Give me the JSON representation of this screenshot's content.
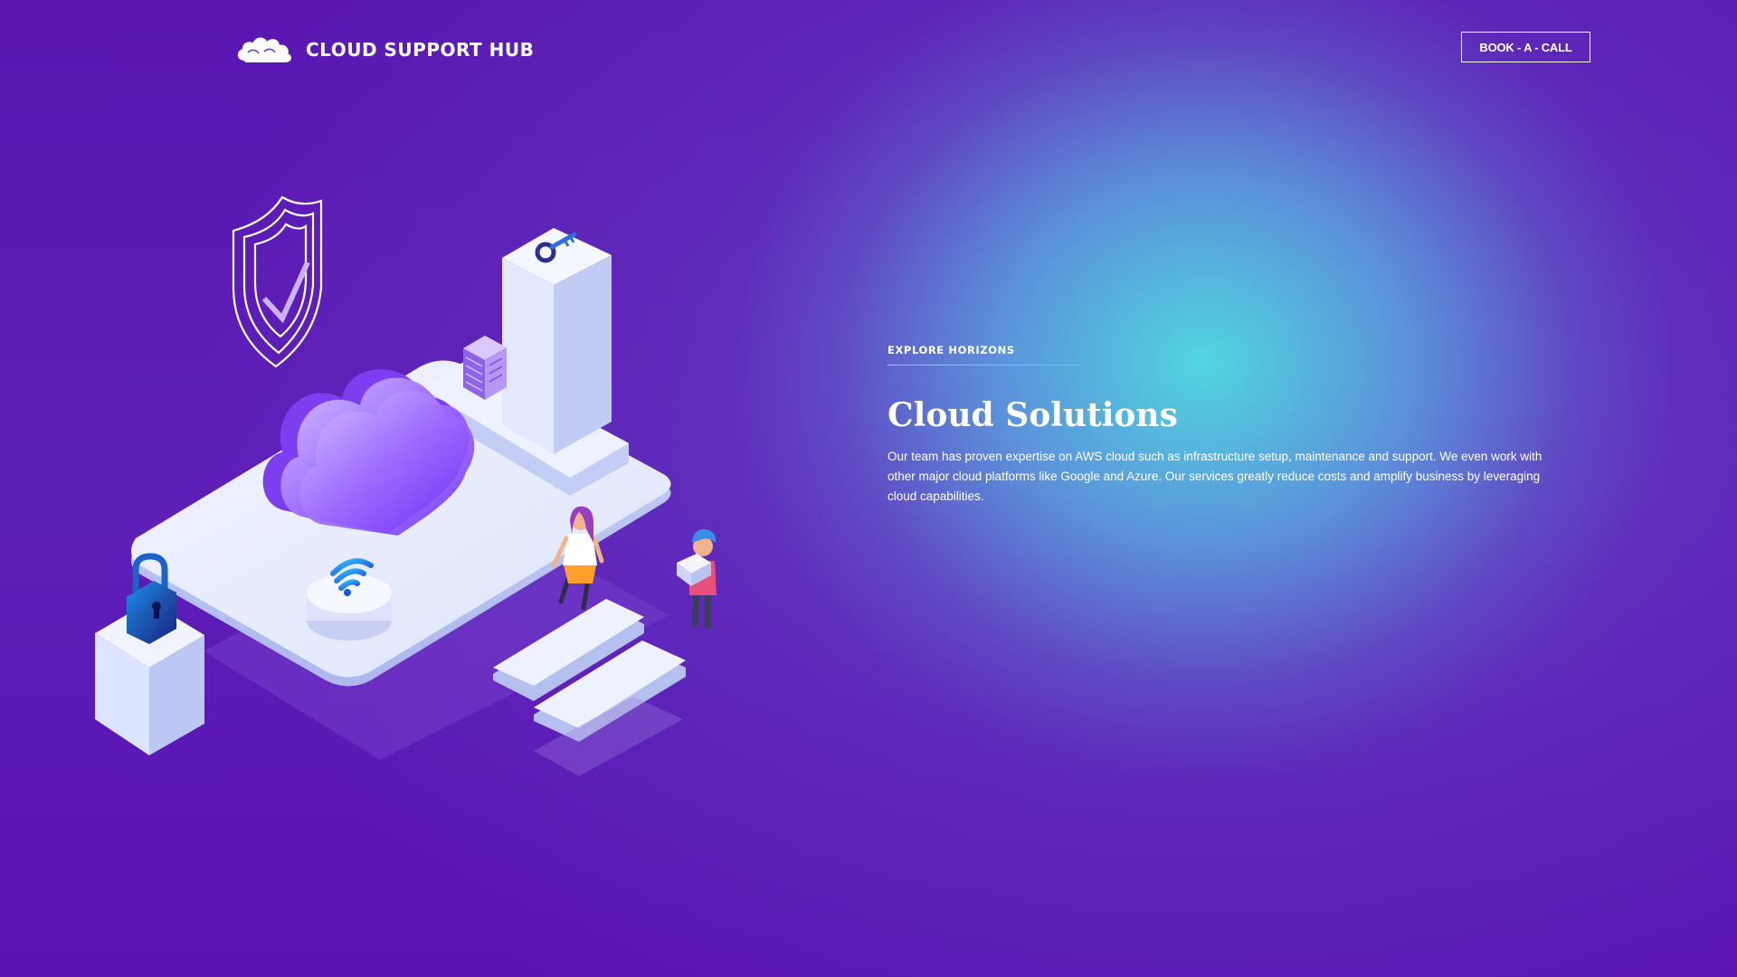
{
  "header": {
    "brand_name": "CLOUD SUPPORT HUB",
    "logo_icon": "cloud-logo-icon",
    "cta_label": "BOOK - A - CALL"
  },
  "hero": {
    "eyebrow": "EXPLORE HORIZONS",
    "title": "Cloud Solutions",
    "description": "Our team has proven expertise on AWS cloud such as infrastructure setup, maintenance and support. We even work with other major cloud platforms like Google and Azure. Our services greatly reduce costs and amplify business by leveraging cloud capabilities."
  },
  "illustration": {
    "icons": [
      "shield-check-icon",
      "cloud-icon",
      "server-icon",
      "key-icon",
      "padlock-icon",
      "wifi-icon"
    ],
    "people": [
      "person-woman",
      "person-man-with-box"
    ]
  },
  "colors": {
    "background_purple": "#5c12b4",
    "glow_cyan": "#50dce1",
    "text": "#ffffff"
  }
}
